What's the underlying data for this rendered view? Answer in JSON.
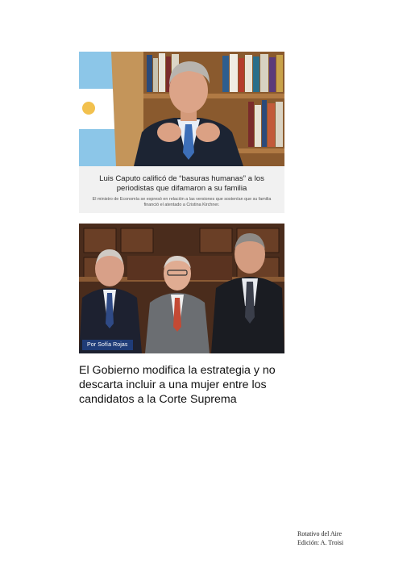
{
  "article1": {
    "headline": "Luis Caputo calificó de “basuras humanas” a los periodistas que difamaron a su familia",
    "summary": "El ministro de Economía se expresó en relación a las versiones que sostenían que su familia financió el atentado a Cristina Kirchner."
  },
  "article2": {
    "author": "Por Sofía Rojas",
    "headline": "El Gobierno modifica la estrategia y no descarta incluir a una mujer entre los candidatos a la Corte Suprema"
  },
  "colophon": {
    "line1": "Rotativo del Aire",
    "line2": "Edición: A. Troisi"
  }
}
